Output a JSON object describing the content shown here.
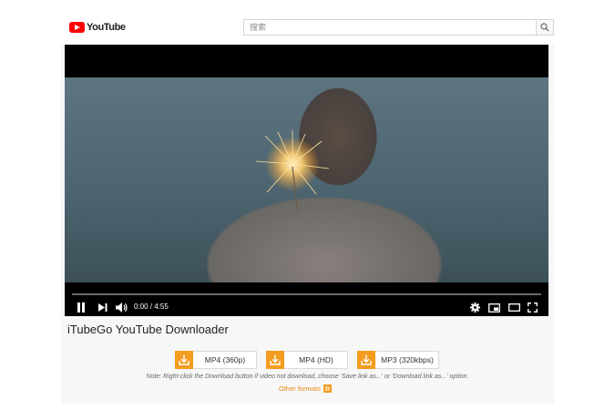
{
  "header": {
    "logo_text": "YouTube",
    "search_placeholder": "搜索"
  },
  "player": {
    "time": "0:00 / 4:55",
    "progress": 0
  },
  "page": {
    "title": "iTubeGo YouTube Downloader"
  },
  "downloads": [
    {
      "label": "MP4 (360p)"
    },
    {
      "label": "MP4 (HD)"
    },
    {
      "label": "MP3 (320kbps)"
    }
  ],
  "note": "Note: Right-click the Download button if video not download, choose 'Save link as...' or 'Download link as...' option.",
  "other_formats": "Other formats",
  "colors": {
    "brand_red": "#ff0000",
    "accent_orange": "#f39c1f"
  }
}
